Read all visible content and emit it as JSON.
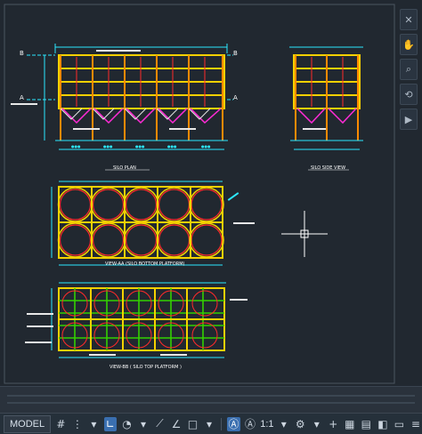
{
  "colors": {
    "canvas": "#212830",
    "frame": "#4c5661",
    "outline": "#2ce9ff",
    "yellow": "#f4d100",
    "magenta": "#ff2bd6",
    "green": "#33d000",
    "red": "#ff2a2a"
  },
  "drawing": {
    "views": {
      "silo_plan": "SILO PLAN",
      "silo_side_view": "SILO SIDE VIEW",
      "view_aa": "VIEW-AA (SILO BOTTOM PLATFORM)",
      "view_bb": "VIEW-BB ( SILO TOP PLATFORM )"
    },
    "section_marks": {
      "b_left": "B",
      "b_right": "B",
      "a_left": "A",
      "a_right": "A"
    }
  },
  "navbar": {
    "items": [
      "close-x",
      "pan",
      "zoom",
      "orbit",
      "showmotion",
      "steering"
    ]
  },
  "statusbar": {
    "model": "MODEL",
    "scale": "1:1"
  }
}
